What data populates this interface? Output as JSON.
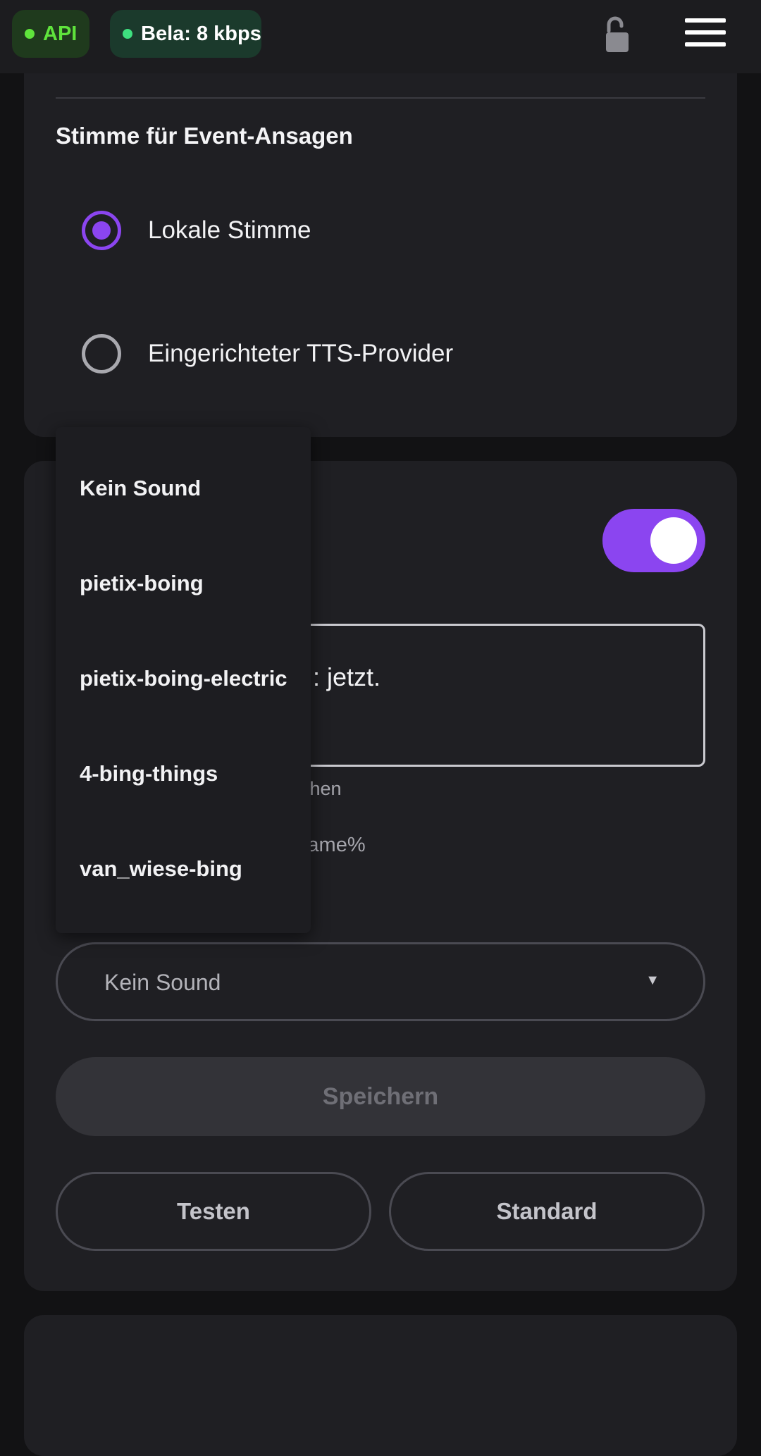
{
  "topbar": {
    "api_label": "API",
    "bela_label": "Bela: 8 kbps",
    "status_color": "#5fe33c"
  },
  "voice_section": {
    "title": "Stimme für Event-Ansagen",
    "options": [
      {
        "label": "Lokale Stimme",
        "selected": true
      },
      {
        "label": "Eingerichteter TTS-Provider",
        "selected": false
      }
    ]
  },
  "event_card": {
    "toggle_on": true,
    "message_text_visible": ": jetzt.",
    "helper_char_count": "ichen",
    "helper_placeholder": "sername%",
    "sound_select": {
      "value": "Kein Sound"
    },
    "save_label": "Speichern",
    "test_label": "Testen",
    "default_label": "Standard"
  },
  "sound_dropdown": {
    "options": [
      "Kein Sound",
      "pietix-boing",
      "pietix-boing-electric",
      "4-bing-things",
      "van_wiese-bing"
    ]
  },
  "accent_color": "#8b45f0"
}
